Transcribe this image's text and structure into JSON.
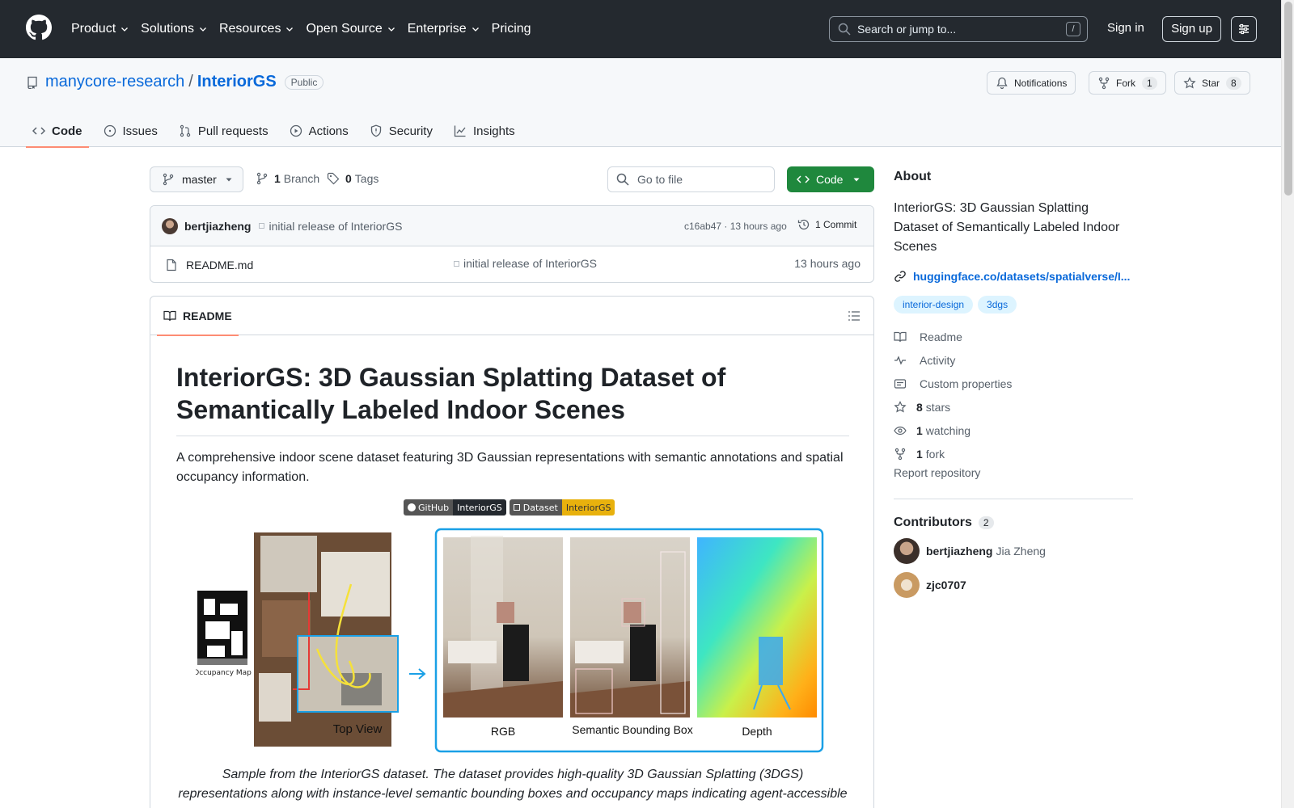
{
  "header": {
    "nav": [
      "Product",
      "Solutions",
      "Resources",
      "Open Source",
      "Enterprise",
      "Pricing"
    ],
    "search_placeholder": "Search or jump to...",
    "search_key": "/",
    "signin": "Sign in",
    "signup": "Sign up"
  },
  "repo": {
    "owner": "manycore-research",
    "name": "InteriorGS",
    "visibility": "Public",
    "notifications": "Notifications",
    "fork_label": "Fork",
    "fork_count": "1",
    "star_label": "Star",
    "star_count": "8",
    "tabs": [
      "Code",
      "Issues",
      "Pull requests",
      "Actions",
      "Security",
      "Insights"
    ]
  },
  "toolbar": {
    "branch": "master",
    "branch_count": "1",
    "branch_label": "Branch",
    "tag_count": "0",
    "tag_label": "Tags",
    "goto_placeholder": "Go to file",
    "code_button": "Code"
  },
  "commit": {
    "author": "bertjiazheng",
    "message": "initial release of InteriorGS",
    "sha_time": "c16ab47 · 13 hours ago",
    "commits_label": "1 Commit"
  },
  "files": [
    {
      "name": "README.md",
      "message": "initial release of InteriorGS",
      "date": "13 hours ago"
    }
  ],
  "readme": {
    "tab_label": "README",
    "title": "InteriorGS: 3D Gaussian Splatting Dataset of Semantically Labeled Indoor Scenes",
    "description": "A comprehensive indoor scene dataset featuring 3D Gaussian representations with semantic annotations and spatial occupancy information.",
    "badges": [
      {
        "left": "GitHub",
        "right": "InteriorGS",
        "color": "#24292f"
      },
      {
        "left": "Dataset",
        "right": "InteriorGS",
        "color": "#e8b10d"
      }
    ],
    "figure_labels": {
      "occupancy": "Occupancy Map",
      "top_view": "Top View",
      "rgb": "RGB",
      "bbox": "Semantic Bounding Box",
      "depth": "Depth"
    },
    "caption_line1": "Sample from the InteriorGS dataset. The dataset provides high-quality 3D Gaussian Splatting (3DGS)",
    "caption_line2": "representations along with instance-level semantic bounding boxes and occupancy maps indicating agent-accessible"
  },
  "about": {
    "heading": "About",
    "description": "InteriorGS: 3D Gaussian Splatting Dataset of Semantically Labeled Indoor Scenes",
    "link": "huggingface.co/datasets/spatialverse/I...",
    "topics": [
      "interior-design",
      "3dgs"
    ],
    "items": [
      {
        "icon": "book-icon",
        "count": "",
        "label": "Readme"
      },
      {
        "icon": "pulse-icon",
        "count": "",
        "label": "Activity"
      },
      {
        "icon": "note-icon",
        "count": "",
        "label": "Custom properties"
      },
      {
        "icon": "star-icon",
        "count": "8",
        "label": "stars"
      },
      {
        "icon": "eye-icon",
        "count": "1",
        "label": "watching"
      },
      {
        "icon": "fork-icon",
        "count": "1",
        "label": "fork"
      }
    ],
    "report": "Report repository"
  },
  "contributors": {
    "heading": "Contributors",
    "count": "2",
    "list": [
      {
        "login": "bertjiazheng",
        "name": "Jia Zheng"
      },
      {
        "login": "zjc0707",
        "name": ""
      }
    ]
  },
  "colors": {
    "accent": "#0969da",
    "green": "#1f883d",
    "tab_underline": "#fd8c73",
    "header_bg": "#24292f"
  }
}
